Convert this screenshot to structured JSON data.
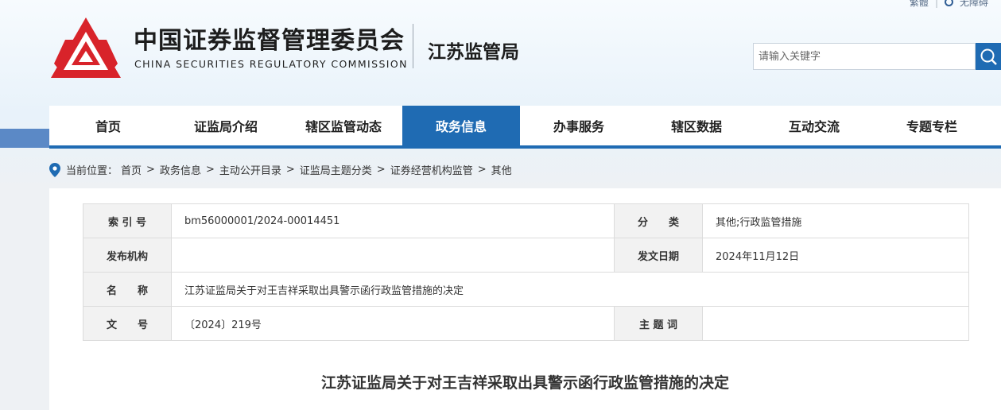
{
  "toplinks": {
    "lang": "繁體",
    "login": "无障碍"
  },
  "header": {
    "org_cn": "中国证券监督管理委员会",
    "org_en": "CHINA SECURITIES REGULATORY COMMISSION",
    "bureau": "江苏监管局",
    "logo_icon": "csrc-logo-icon",
    "brand_color": "#d8232a"
  },
  "search": {
    "placeholder": "请输入关键字",
    "button_icon": "search-icon"
  },
  "nav": {
    "accent": "#1f6bb3",
    "items": [
      "首页",
      "证监局介绍",
      "辖区监管动态",
      "政务信息",
      "办事服务",
      "辖区数据",
      "互动交流",
      "专题专栏"
    ],
    "active": "政务信息"
  },
  "breadcrumb": {
    "prefix": "当前位置：",
    "items": [
      "首页",
      "政务信息",
      "主动公开目录",
      "证监局主题分类",
      "证券经营机构监管",
      "其他"
    ]
  },
  "meta": {
    "index_label": "索 引 号",
    "index_value": "bm56000001/2024-00014451",
    "category_label": "分　　类",
    "category_value": "其他;行政监管措施",
    "publisher_label": "发布机构",
    "publisher_value": "",
    "date_label": "发文日期",
    "date_value": "2024年11月12日",
    "name_label": "名　　称",
    "name_value": "江苏证监局关于对王吉祥采取出具警示函行政监管措施的决定",
    "docno_label": "文　　号",
    "docno_value": "〔2024〕219号",
    "subject_label": "主 题 词",
    "subject_value": ""
  },
  "doc_title": "江苏证监局关于对王吉祥采取出具警示函行政监管措施的决定"
}
